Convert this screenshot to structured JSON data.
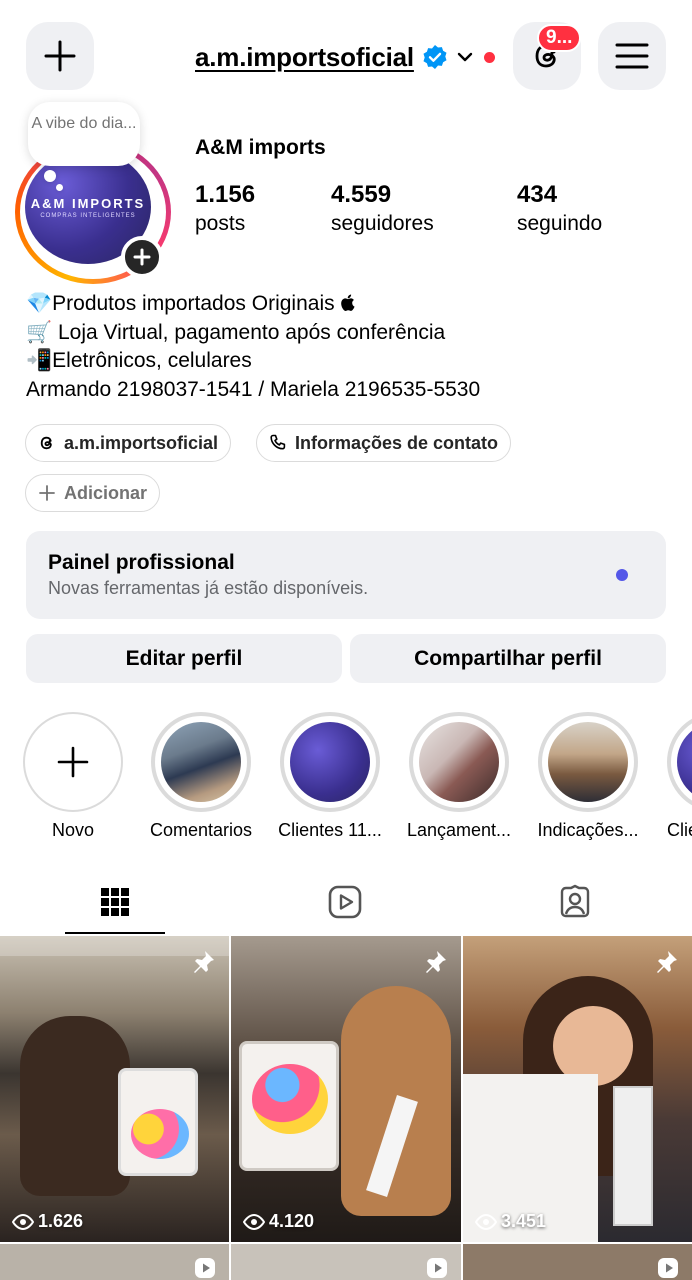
{
  "header": {
    "username": "a.m.importsoficial",
    "notifications_badge": "9..."
  },
  "profile": {
    "note": "A vibe do dia...",
    "avatar_title": "A&M IMPORTS",
    "avatar_subtitle": "COMPRAS INTELIGENTES",
    "display_name": "A&M imports",
    "stats": [
      {
        "value": "1.156",
        "label": "posts"
      },
      {
        "value": "4.559",
        "label": "seguidores"
      },
      {
        "value": "434",
        "label": "seguindo"
      }
    ],
    "bio": [
      "💎Produtos importados Originais ",
      "🛒 Loja Virtual, pagamento após conferência",
      "📲Eletrônicos, celulares",
      "Armando 2198037-1541 / Mariela 2196535-5530"
    ],
    "threads_chip": "a.m.importsoficial",
    "contact_chip": "Informações de contato",
    "add_chip": "Adicionar"
  },
  "pro_panel": {
    "title": "Painel profissional",
    "subtitle": "Novas ferramentas já estão disponíveis."
  },
  "buttons": {
    "edit": "Editar perfil",
    "share": "Compartilhar perfil"
  },
  "highlights": [
    {
      "label": "Novo"
    },
    {
      "label": "Comentarios"
    },
    {
      "label": "Clientes 11..."
    },
    {
      "label": "Lançament..."
    },
    {
      "label": "Indicações..."
    },
    {
      "label": "Clie"
    }
  ],
  "grid": {
    "posts": [
      {
        "views": "1.626",
        "pinned": true
      },
      {
        "views": "4.120",
        "pinned": true
      },
      {
        "views": "3.451",
        "pinned": true
      }
    ]
  },
  "colors": {
    "accent_blue": "#0095f6",
    "badge_red": "#ff3040",
    "panel_dot": "#5457e8"
  }
}
